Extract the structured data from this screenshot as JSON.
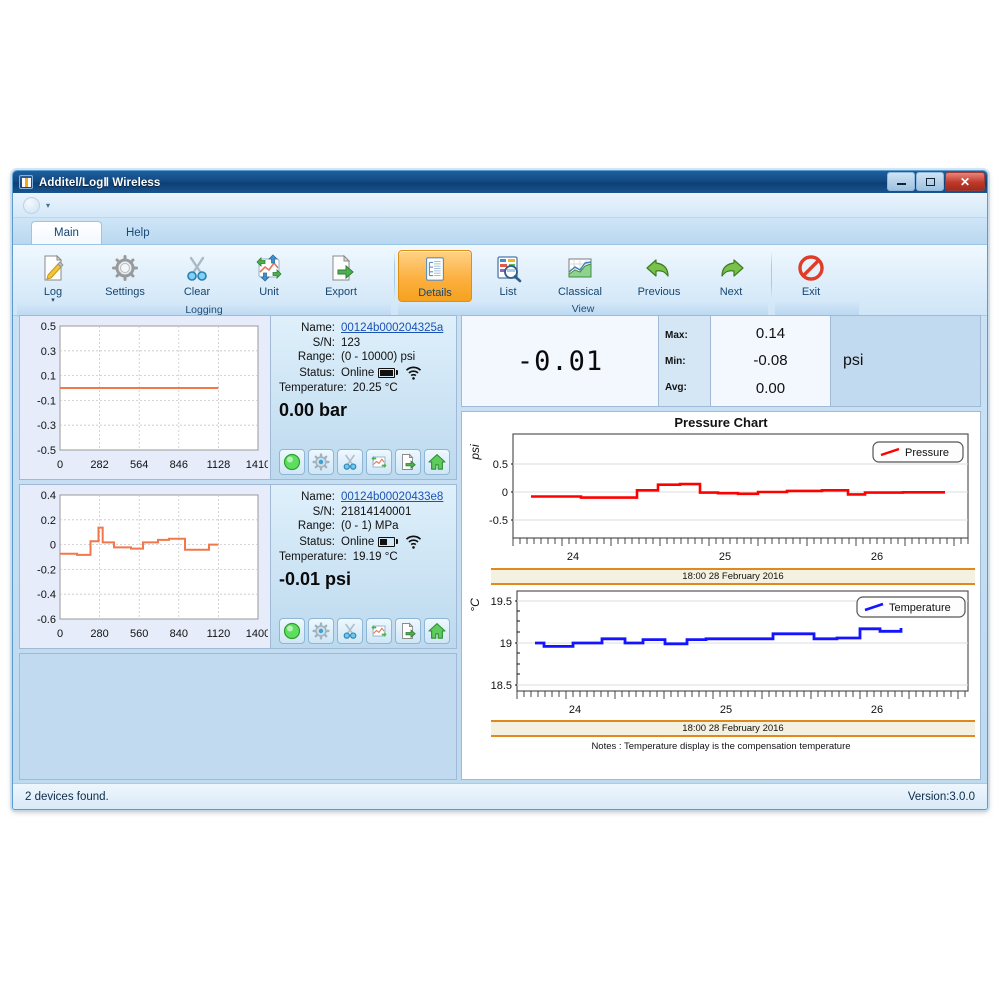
{
  "window": {
    "title": "Additel/LogⅡ Wireless",
    "icon": "app-icon",
    "minimize_label": "Minimize",
    "maximize_label": "Maximize",
    "close_label": "✕"
  },
  "quick_access": {
    "orb_label": "",
    "caret": "▾"
  },
  "tabs": [
    {
      "label": "Main",
      "active": true
    },
    {
      "label": "Help",
      "active": false
    }
  ],
  "ribbon": {
    "groups": [
      {
        "label": "Logging",
        "buttons": [
          {
            "label": "Log",
            "icon": "log-pencil-icon",
            "has_caret": true,
            "selected": false
          },
          {
            "label": "Settings",
            "icon": "gear-icon",
            "has_caret": false,
            "selected": false
          },
          {
            "label": "Clear",
            "icon": "scissors-icon",
            "has_caret": false,
            "selected": false
          },
          {
            "label": "Unit",
            "icon": "unit-convert-icon",
            "has_caret": false,
            "selected": false
          },
          {
            "label": "Export",
            "icon": "export-icon",
            "has_caret": false,
            "selected": false
          }
        ]
      },
      {
        "label": "View",
        "buttons": [
          {
            "label": "Details",
            "icon": "details-icon",
            "has_caret": false,
            "selected": true
          },
          {
            "label": "List",
            "icon": "list-search-icon",
            "has_caret": false,
            "selected": false
          },
          {
            "label": "Classical",
            "icon": "classical-chart-icon",
            "has_caret": false,
            "selected": false
          },
          {
            "label": "Previous",
            "icon": "arrow-left-icon",
            "has_caret": false,
            "selected": false
          },
          {
            "label": "Next",
            "icon": "arrow-right-icon",
            "has_caret": false,
            "selected": false
          }
        ]
      },
      {
        "label": "",
        "buttons": [
          {
            "label": "Exit",
            "icon": "exit-forbidden-icon",
            "has_caret": false,
            "selected": false
          }
        ]
      }
    ]
  },
  "devices": [
    {
      "name_label": "Name:",
      "name_value": "00124b000204325a",
      "sn_label": "S/N:",
      "sn_value": "123",
      "range_label": "Range:",
      "range_value": "(0 - 10000) psi",
      "status_label": "Status:",
      "status_value": "Online",
      "battery_level": 100,
      "temperature_label": "Temperature:",
      "temperature_value": "20.25 °C",
      "reading": "0.00 bar",
      "actions": [
        "log-record-icon",
        "settings-gear-icon",
        "clear-scissors-icon",
        "unit-convert-icon",
        "export-icon",
        "home-icon"
      ]
    },
    {
      "name_label": "Name:",
      "name_value": "00124b00020433e8",
      "sn_label": "S/N:",
      "sn_value": "21814140001",
      "range_label": "Range:",
      "range_value": "(0 - 1) MPa",
      "status_label": "Status:",
      "status_value": "Online",
      "battery_level": 55,
      "temperature_label": "Temperature:",
      "temperature_value": "19.19 °C",
      "reading": "-0.01 psi",
      "actions": [
        "log-record-icon",
        "settings-gear-icon",
        "clear-scissors-icon",
        "unit-convert-icon",
        "export-icon",
        "home-icon"
      ]
    }
  ],
  "readout": {
    "value": "-0.01",
    "max_label": "Max:",
    "max_value": "0.14",
    "min_label": "Min:",
    "min_value": "-0.08",
    "avg_label": "Avg:",
    "avg_value": "0.00",
    "unit": "psi"
  },
  "notes": "Notes : Temperature display is the compensation temperature",
  "statusbar": {
    "devices_found": "2  devices found.",
    "version": "Version:3.0.0"
  },
  "chart_data": [
    {
      "id": "device1-mini",
      "type": "line",
      "title": "",
      "xlabel": "",
      "ylabel": "",
      "xticks": [
        0,
        282,
        564,
        846,
        1128,
        1410
      ],
      "yticks": [
        -0.5,
        -0.3,
        -0.1,
        0.1,
        0.3,
        0.5
      ],
      "xlim": [
        0,
        1410
      ],
      "ylim": [
        -0.5,
        0.5
      ],
      "grid": true,
      "color": "#f2784b",
      "x": [
        0,
        1128
      ],
      "values": [
        0.0,
        0.0
      ]
    },
    {
      "id": "device2-mini",
      "type": "line",
      "title": "",
      "xlabel": "",
      "ylabel": "",
      "xticks": [
        0,
        280,
        560,
        840,
        1120,
        1400
      ],
      "yticks": [
        -0.6,
        -0.4,
        -0.2,
        0,
        0.2,
        0.4
      ],
      "xlim": [
        0,
        1400
      ],
      "ylim": [
        -0.6,
        0.4
      ],
      "grid": true,
      "color": "#f2784b",
      "x": [
        0,
        120,
        130,
        225,
        235,
        290,
        300,
        330,
        340,
        420,
        430,
        500,
        510,
        590,
        600,
        690,
        700,
        780,
        790,
        880,
        890,
        960,
        970,
        1060,
        1070,
        1120
      ],
      "values": [
        -0.07,
        -0.07,
        -0.08,
        -0.08,
        0.03,
        0.03,
        0.14,
        0.14,
        0.02,
        0.02,
        -0.02,
        -0.02,
        -0.03,
        -0.03,
        0.02,
        0.02,
        0.04,
        0.04,
        0.05,
        0.05,
        -0.04,
        -0.04,
        -0.04,
        -0.04,
        0.0,
        0.0
      ]
    },
    {
      "id": "pressure-chart",
      "type": "line",
      "title": "Pressure Chart",
      "ylabel": "psi",
      "xlabel": "",
      "legend": "Pressure",
      "legend_position": "top-right",
      "color": "#ff0000",
      "yticks": [
        -0.5,
        0,
        0.5
      ],
      "ylim": [
        -0.85,
        0.85
      ],
      "xticks": [
        24,
        25,
        26
      ],
      "xlim": [
        23.6,
        26.6
      ],
      "grid": true,
      "timebar": "18:00 28 February 2016",
      "x": [
        23.72,
        24.05,
        24.08,
        24.45,
        24.48,
        24.62,
        24.65,
        24.78,
        24.8,
        24.93,
        24.96,
        25.08,
        25.11,
        25.24,
        25.27,
        25.4,
        25.43,
        25.62,
        25.65,
        25.88,
        25.91,
        26.08,
        26.11,
        26.22,
        26.25,
        26.5
      ],
      "values": [
        -0.08,
        -0.08,
        -0.1,
        -0.1,
        0.03,
        0.03,
        0.13,
        0.13,
        0.14,
        0.14,
        -0.01,
        -0.01,
        -0.02,
        -0.02,
        -0.03,
        -0.03,
        0.0,
        0.0,
        0.02,
        0.02,
        0.03,
        0.03,
        -0.04,
        -0.04,
        -0.01,
        -0.01
      ]
    },
    {
      "id": "temperature-chart",
      "type": "line",
      "title": "",
      "ylabel": "°C",
      "xlabel": "",
      "legend": "Temperature",
      "legend_position": "top-right",
      "color": "#1414ff",
      "yticks": [
        18.5,
        19,
        19.5
      ],
      "ylim": [
        18.38,
        19.72
      ],
      "xticks": [
        24,
        25,
        26
      ],
      "xlim": [
        23.6,
        26.6
      ],
      "grid": true,
      "timebar": "18:00 28 February 2016",
      "x": [
        23.72,
        23.78,
        23.81,
        24.0,
        24.03,
        24.22,
        24.25,
        24.4,
        24.43,
        24.55,
        24.58,
        24.72,
        24.75,
        24.9,
        24.93,
        25.05,
        25.08,
        25.52,
        25.55,
        25.82,
        25.85,
        26.0,
        26.03,
        26.18,
        26.21,
        26.34,
        26.37,
        26.52
      ],
      "values": [
        19.0,
        19.0,
        18.96,
        18.96,
        19.0,
        19.0,
        19.05,
        19.05,
        19.0,
        19.0,
        19.04,
        19.04,
        18.99,
        18.99,
        19.03,
        19.03,
        19.04,
        19.04,
        19.1,
        19.1,
        19.04,
        19.04,
        19.05,
        19.05,
        19.16,
        19.16,
        19.13,
        19.17
      ]
    }
  ]
}
